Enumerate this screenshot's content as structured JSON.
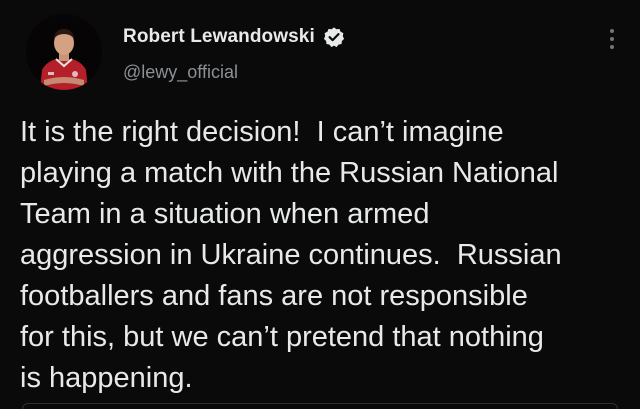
{
  "author": {
    "display_name": "Robert Lewandowski",
    "handle": "@lewy_official",
    "verified": true
  },
  "tweet": {
    "lines": [
      "It is the right decision!  I can’t imagine",
      "playing a match with the Russian National",
      "Team in a situation when armed",
      "aggression in Ukraine continues.  Russian",
      "footballers and fans are not responsible",
      "for this, but we can’t pretend that nothing",
      "is happening."
    ]
  },
  "icons": {
    "verified": "verified-badge-icon",
    "more": "more-options-icon"
  },
  "colors": {
    "background": "#0a0a0a",
    "text": "#e7e9ea",
    "secondary_text": "#8b9096",
    "jersey": "#b3202a"
  }
}
